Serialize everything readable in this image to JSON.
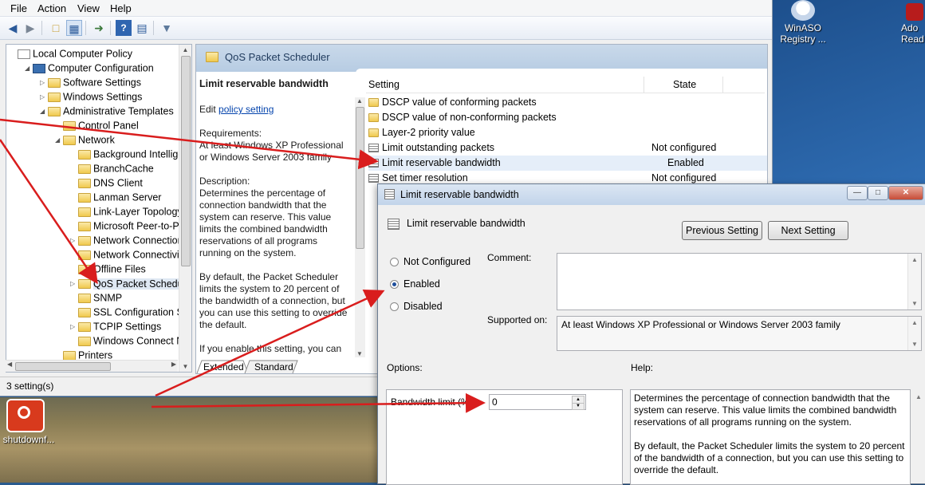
{
  "menu": [
    "File",
    "Action",
    "View",
    "Help"
  ],
  "toolbar_icons": [
    "back-arrow-icon",
    "forward-arrow-icon",
    "up-folder-icon",
    "show-hide-tree-icon",
    "export-list-icon",
    "help-icon",
    "properties-icon",
    "filter-icon"
  ],
  "tree": {
    "items": [
      {
        "label": "Local Computer Policy",
        "indent": 0,
        "exp": "",
        "icon": "policy"
      },
      {
        "label": "Computer Configuration",
        "indent": 1,
        "exp": "◢",
        "icon": "computer"
      },
      {
        "label": "Software Settings",
        "indent": 2,
        "exp": "▷",
        "icon": "folder"
      },
      {
        "label": "Windows Settings",
        "indent": 2,
        "exp": "▷",
        "icon": "folder"
      },
      {
        "label": "Administrative Templates",
        "indent": 2,
        "exp": "◢",
        "icon": "folder"
      },
      {
        "label": "Control Panel",
        "indent": 3,
        "exp": "",
        "icon": "folder"
      },
      {
        "label": "Network",
        "indent": 3,
        "exp": "◢",
        "icon": "folder"
      },
      {
        "label": "Background Intelliger",
        "indent": 4,
        "exp": "",
        "icon": "folder"
      },
      {
        "label": "BranchCache",
        "indent": 4,
        "exp": "",
        "icon": "folder"
      },
      {
        "label": "DNS Client",
        "indent": 4,
        "exp": "",
        "icon": "folder"
      },
      {
        "label": "Lanman Server",
        "indent": 4,
        "exp": "",
        "icon": "folder"
      },
      {
        "label": "Link-Layer Topology",
        "indent": 4,
        "exp": "",
        "icon": "folder"
      },
      {
        "label": "Microsoft Peer-to-Pe",
        "indent": 4,
        "exp": "",
        "icon": "folder"
      },
      {
        "label": "Network Connections",
        "indent": 4,
        "exp": "▷",
        "icon": "folder"
      },
      {
        "label": "Network Connectivity",
        "indent": 4,
        "exp": "",
        "icon": "folder"
      },
      {
        "label": "Offline Files",
        "indent": 4,
        "exp": "",
        "icon": "folder"
      },
      {
        "label": "QoS Packet Scheduler",
        "indent": 4,
        "exp": "▷",
        "icon": "folder",
        "selected": true
      },
      {
        "label": "SNMP",
        "indent": 4,
        "exp": "",
        "icon": "folder"
      },
      {
        "label": "SSL Configuration Set",
        "indent": 4,
        "exp": "",
        "icon": "folder"
      },
      {
        "label": "TCPIP Settings",
        "indent": 4,
        "exp": "▷",
        "icon": "folder"
      },
      {
        "label": "Windows Connect Nc",
        "indent": 4,
        "exp": "",
        "icon": "folder"
      },
      {
        "label": "Printers",
        "indent": 3,
        "exp": "",
        "icon": "folder"
      }
    ]
  },
  "right_pane": {
    "header_title": "QoS Packet Scheduler",
    "description": {
      "heading": "Limit reservable bandwidth",
      "edit_prefix": "Edit ",
      "edit_link": "policy setting",
      "requirements_label": "Requirements:",
      "requirements_text": "At least Windows XP Professional or Windows Server 2003 family",
      "description_label": "Description:",
      "description_text": "Determines the percentage of connection bandwidth that the system can reserve. This value limits the combined bandwidth reservations of all programs running on the system.",
      "default_text": "By default, the Packet Scheduler limits the system to 20 percent of the bandwidth of a connection, but you can use this setting to override the default.",
      "enable_text": "If you enable this setting, you can"
    },
    "columns": {
      "setting": "Setting",
      "state": "State"
    },
    "rows": [
      {
        "name": "DSCP value of conforming packets",
        "state": "",
        "icon": "folder"
      },
      {
        "name": "DSCP value of non-conforming packets",
        "state": "",
        "icon": "folder"
      },
      {
        "name": "Layer-2 priority value",
        "state": "",
        "icon": "folder"
      },
      {
        "name": "Limit outstanding packets",
        "state": "Not configured",
        "icon": "setting"
      },
      {
        "name": "Limit reservable bandwidth",
        "state": "Enabled",
        "icon": "setting",
        "selected": true
      },
      {
        "name": "Set timer resolution",
        "state": "Not configured",
        "icon": "setting"
      }
    ],
    "tabs": [
      "Extended",
      "Standard"
    ]
  },
  "status_bar": "3 setting(s)",
  "dialog": {
    "title": "Limit reservable bandwidth",
    "subtitle": "Limit reservable bandwidth",
    "prev_button": "Previous Setting",
    "next_button": "Next Setting",
    "radio_options": [
      "Not Configured",
      "Enabled",
      "Disabled"
    ],
    "selected_radio": "Enabled",
    "comment_label": "Comment:",
    "comment_value": "",
    "supported_label": "Supported on:",
    "supported_value": "At least Windows XP Professional or Windows Server 2003 family",
    "options_label": "Options:",
    "help_label": "Help:",
    "bandwidth_label": "Bandwidth limit (%):",
    "bandwidth_value": "0",
    "help_text_1": "Determines the percentage of connection bandwidth that the system can reserve. This value limits the combined bandwidth reservations of all programs running on the system.",
    "help_text_2": "By default, the Packet Scheduler limits the system to 20 percent of the bandwidth of a connection, but you can use this setting to override the default."
  },
  "desktop": {
    "icons": [
      {
        "label": "WinASO Registry ...",
        "name": "winaso-registry-icon"
      },
      {
        "label": "Ado Read",
        "name": "adobe-reader-icon"
      },
      {
        "label": "shutdownf...",
        "name": "shutdown-icon"
      }
    ]
  },
  "colors": {
    "accent": "#1f4f9c",
    "annotation_arrow": "#d91d1d",
    "header": "#c9d9ea"
  }
}
